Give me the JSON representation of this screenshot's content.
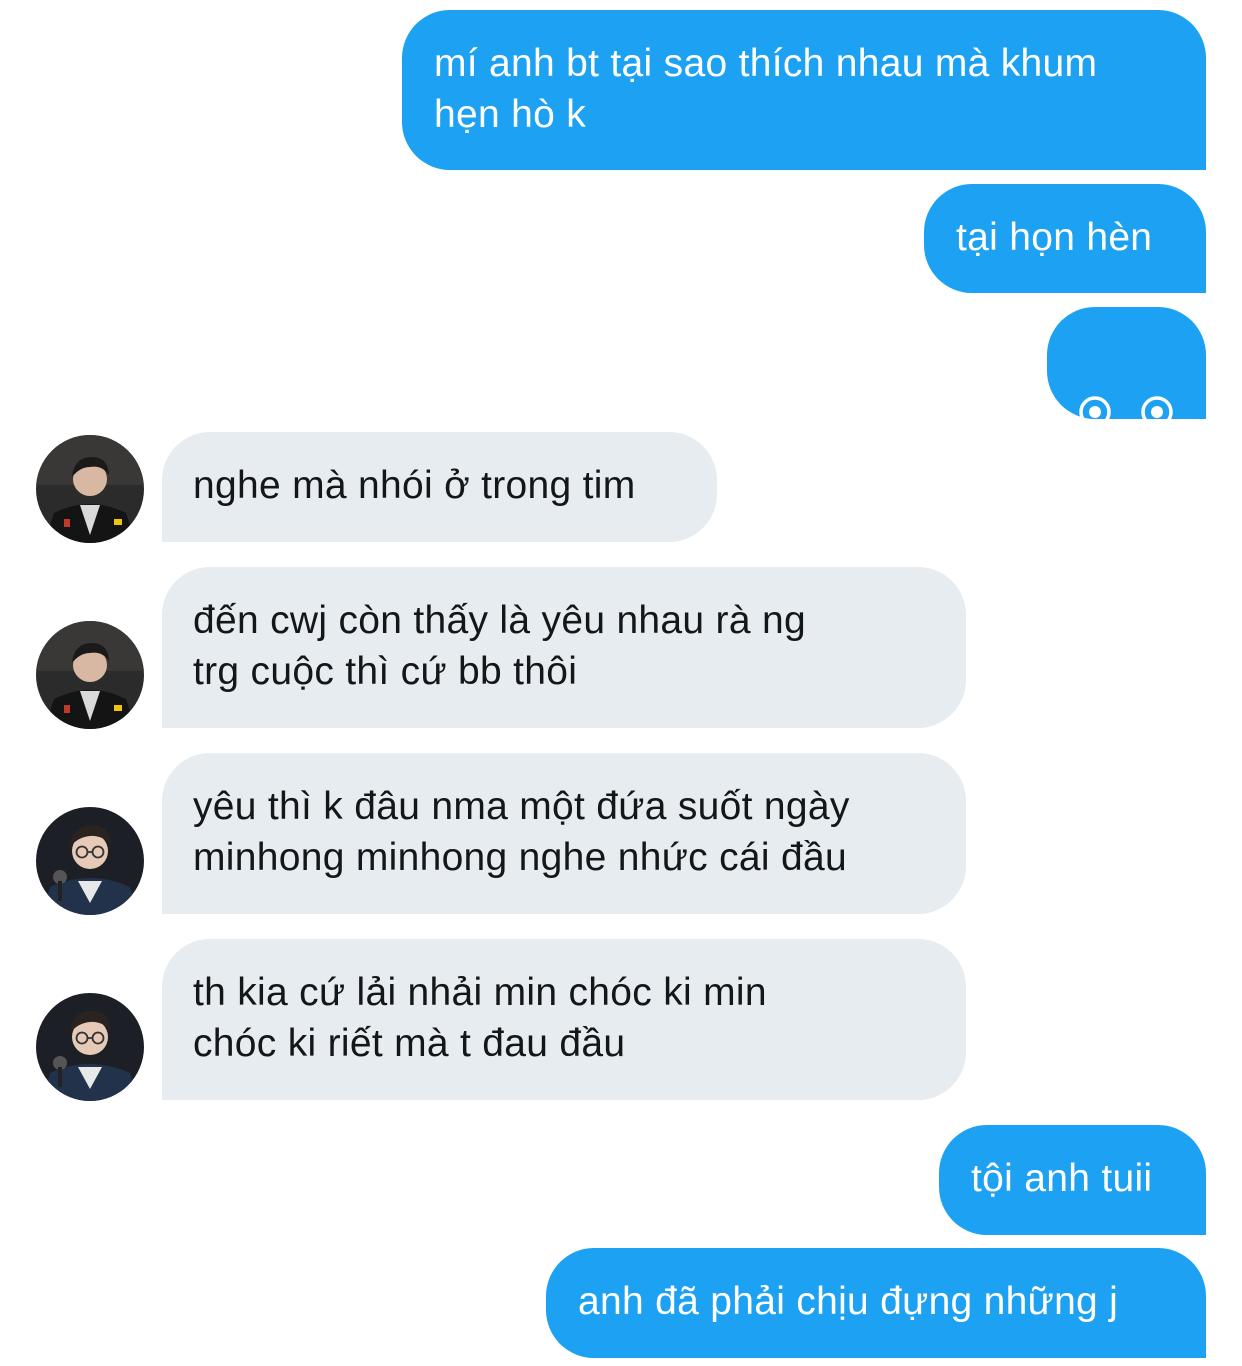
{
  "conversation": {
    "messages": [
      {
        "id": "m1",
        "direction": "outgoing",
        "text": "mí anh bt tại sao thích nhau mà khum\nhẹn hò k"
      },
      {
        "id": "m2",
        "direction": "outgoing",
        "text": "tại họn hèn"
      },
      {
        "id": "m3",
        "direction": "outgoing",
        "text": "",
        "kaomoji": "eyes-smile"
      },
      {
        "id": "m4",
        "direction": "incoming",
        "text": "nghe mà nhói ở trong tim",
        "avatar": "avatar-dark-jacket"
      },
      {
        "id": "m5",
        "direction": "incoming",
        "text": "đến cwj còn thấy là yêu nhau rà ng\ntrg cuộc thì cứ bb thôi",
        "avatar": "avatar-dark-jacket"
      },
      {
        "id": "m6",
        "direction": "incoming",
        "text": "yêu thì k đâu nma một đứa suốt ngày\nminhong minhong nghe nhức cái đầu",
        "avatar": "avatar-glasses-microphone"
      },
      {
        "id": "m7",
        "direction": "incoming",
        "text": "th kia cứ lải nhải min chóc ki min\nchóc ki riết mà t đau đầu",
        "avatar": "avatar-glasses-microphone"
      },
      {
        "id": "m8",
        "direction": "outgoing",
        "text": "tội anh tuii"
      },
      {
        "id": "m9",
        "direction": "outgoing",
        "text": "anh đã phải chịu đựng những j"
      }
    ]
  },
  "colors": {
    "outgoing_bubble": "#1da1f2",
    "incoming_bubble": "#e6ecf0",
    "outgoing_text": "#ffffff",
    "incoming_text": "#14171a"
  }
}
